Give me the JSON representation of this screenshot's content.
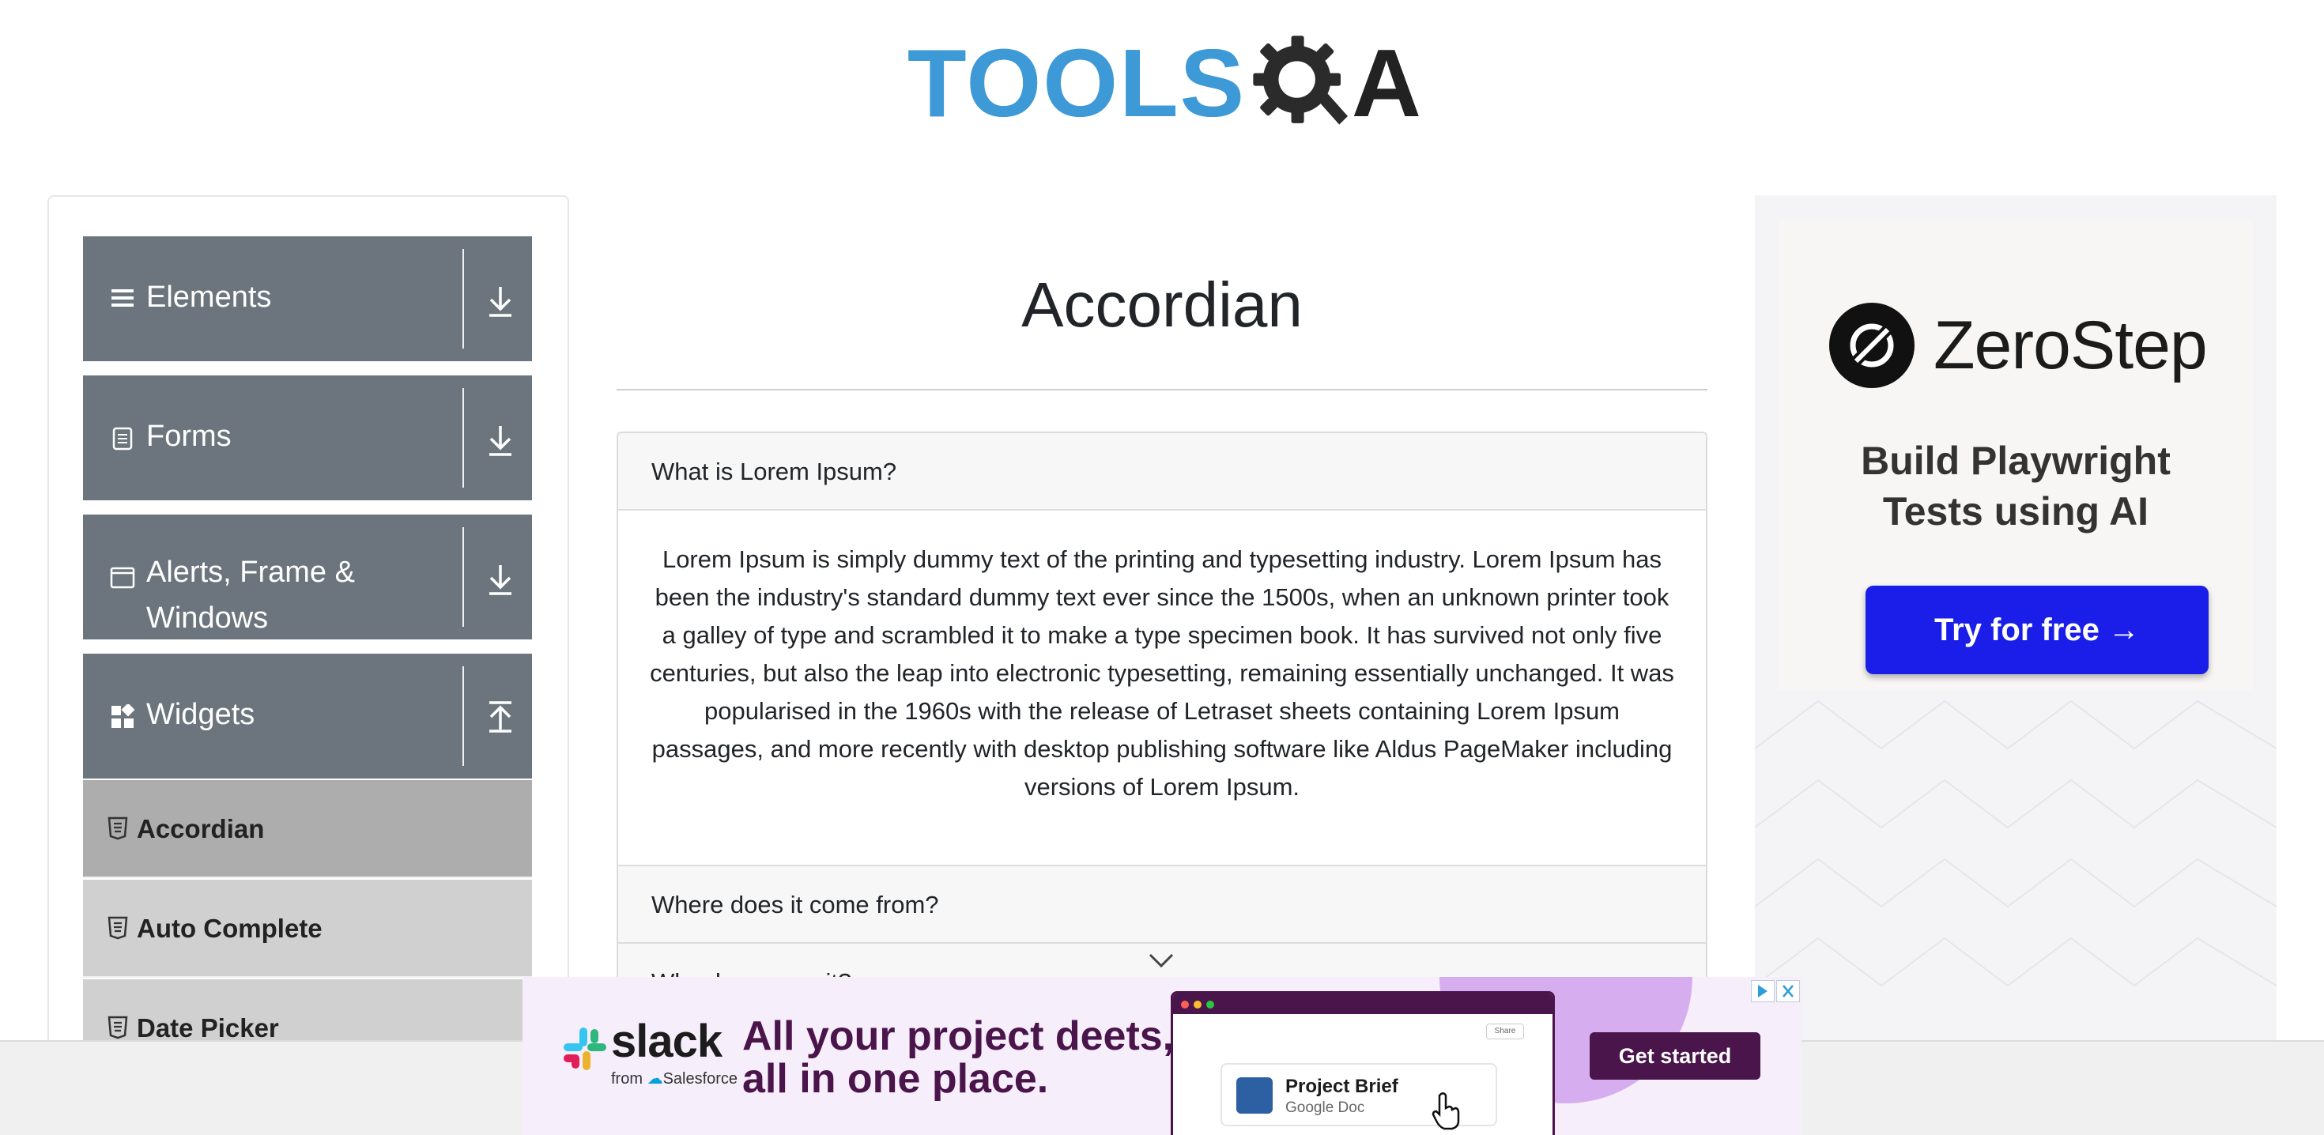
{
  "brand": {
    "logo_main": "TOOLS",
    "logo_suffix": "A",
    "primary_color": "#3d9ad6"
  },
  "sidebar": {
    "groups": [
      {
        "label": "Elements",
        "icon": "list-icon",
        "arrow": "download-arrow-icon"
      },
      {
        "label": "Forms",
        "icon": "document-icon",
        "arrow": "download-arrow-icon"
      },
      {
        "label": "Alerts, Frame &",
        "label2": "Windows",
        "icon": "window-icon",
        "arrow": "download-arrow-icon"
      },
      {
        "label": "Widgets",
        "icon": "widgets-icon",
        "arrow": "upload-arrow-icon"
      }
    ],
    "widget_items": [
      {
        "label": "Accordian",
        "active": true
      },
      {
        "label": "Auto Complete",
        "active": false
      },
      {
        "label": "Date Picker",
        "active": false
      }
    ]
  },
  "main": {
    "title": "Accordian",
    "sections": [
      {
        "heading": "What is Lorem Ipsum?",
        "expanded": true,
        "body": "Lorem Ipsum is simply dummy text of the printing and typesetting industry. Lorem Ipsum has been the industry's standard dummy text ever since the 1500s, when an unknown printer took a galley of type and scrambled it to make a type specimen book. It has survived not only five centuries, but also the leap into electronic typesetting, remaining essentially unchanged. It was popularised in the 1960s with the release of Letraset sheets containing Lorem Ipsum passages, and more recently with desktop publishing software like Aldus PageMaker including versions of Lorem Ipsum."
      },
      {
        "heading": "Where does it come from?",
        "expanded": false
      },
      {
        "heading": "Why do we use it?",
        "expanded": false
      }
    ]
  },
  "right_ad": {
    "brand": "ZeroStep",
    "tagline_1": "Build Playwright",
    "tagline_2": "Tests using AI",
    "cta": "Try for free →",
    "cta_color": "#1b1de8"
  },
  "bottom_ad": {
    "brand": "slack",
    "brand_sub": "from",
    "brand_sub2": "Salesforce",
    "headline_1": "All your project deets,",
    "headline_2": "all in one place.",
    "share_label": "Share",
    "doc_title": "Project Brief",
    "doc_type": "Google Doc",
    "cta": "Get started",
    "accent_color": "#4a154b"
  }
}
